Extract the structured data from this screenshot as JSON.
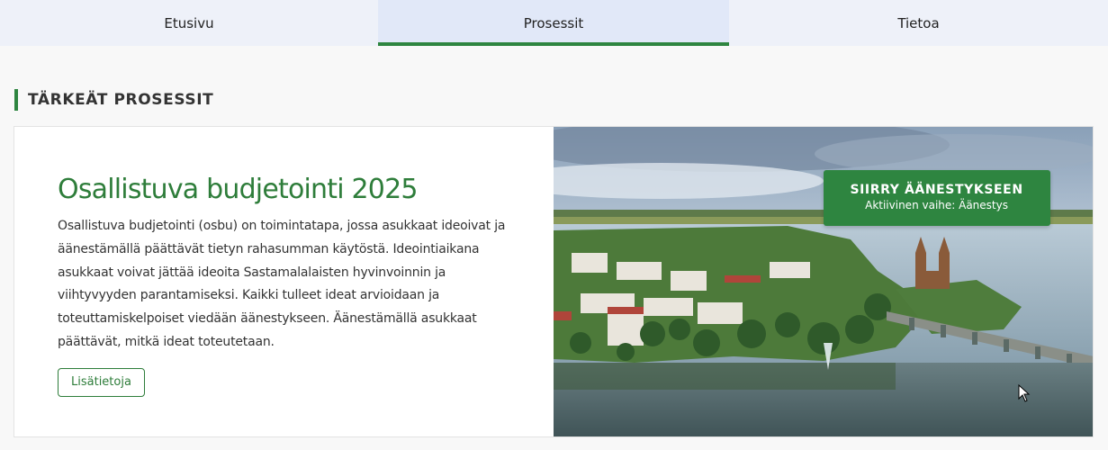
{
  "nav": {
    "tabs": [
      {
        "label": "Etusivu"
      },
      {
        "label": "Prosessit"
      },
      {
        "label": "Tietoa"
      }
    ],
    "active_tab": "Prosessit"
  },
  "section": {
    "title": "TÄRKEÄT PROSESSIT"
  },
  "process_card": {
    "title": "Osallistuva budjetointi 2025",
    "description": "Osallistuva budjetointi (osbu) on toimintatapa, jossa asukkaat ideoivat ja äänestämällä päättävät tietyn rahasumman käytöstä. Ideointiaikana asukkaat voivat jättää ideoita Sastamalalaisten hyvinvoinnin ja viihtyvyyden parantamiseksi. Kaikki tulleet ideat arvioidaan ja toteuttamiskelpoiset viedään äänestykseen. Äänestämällä asukkaat päättävät, mitkä ideat toteutetaan.",
    "more_label": "Lisätietoja",
    "vote_button": {
      "label": "SIIRRY ÄÄNESTYKSEEN",
      "phase": "Aktiivinen vaihe: Äänestys"
    }
  },
  "colors": {
    "accent": "#2e8540",
    "nav_bg": "#eef1f9",
    "nav_active_bg": "#e1e8f8"
  }
}
